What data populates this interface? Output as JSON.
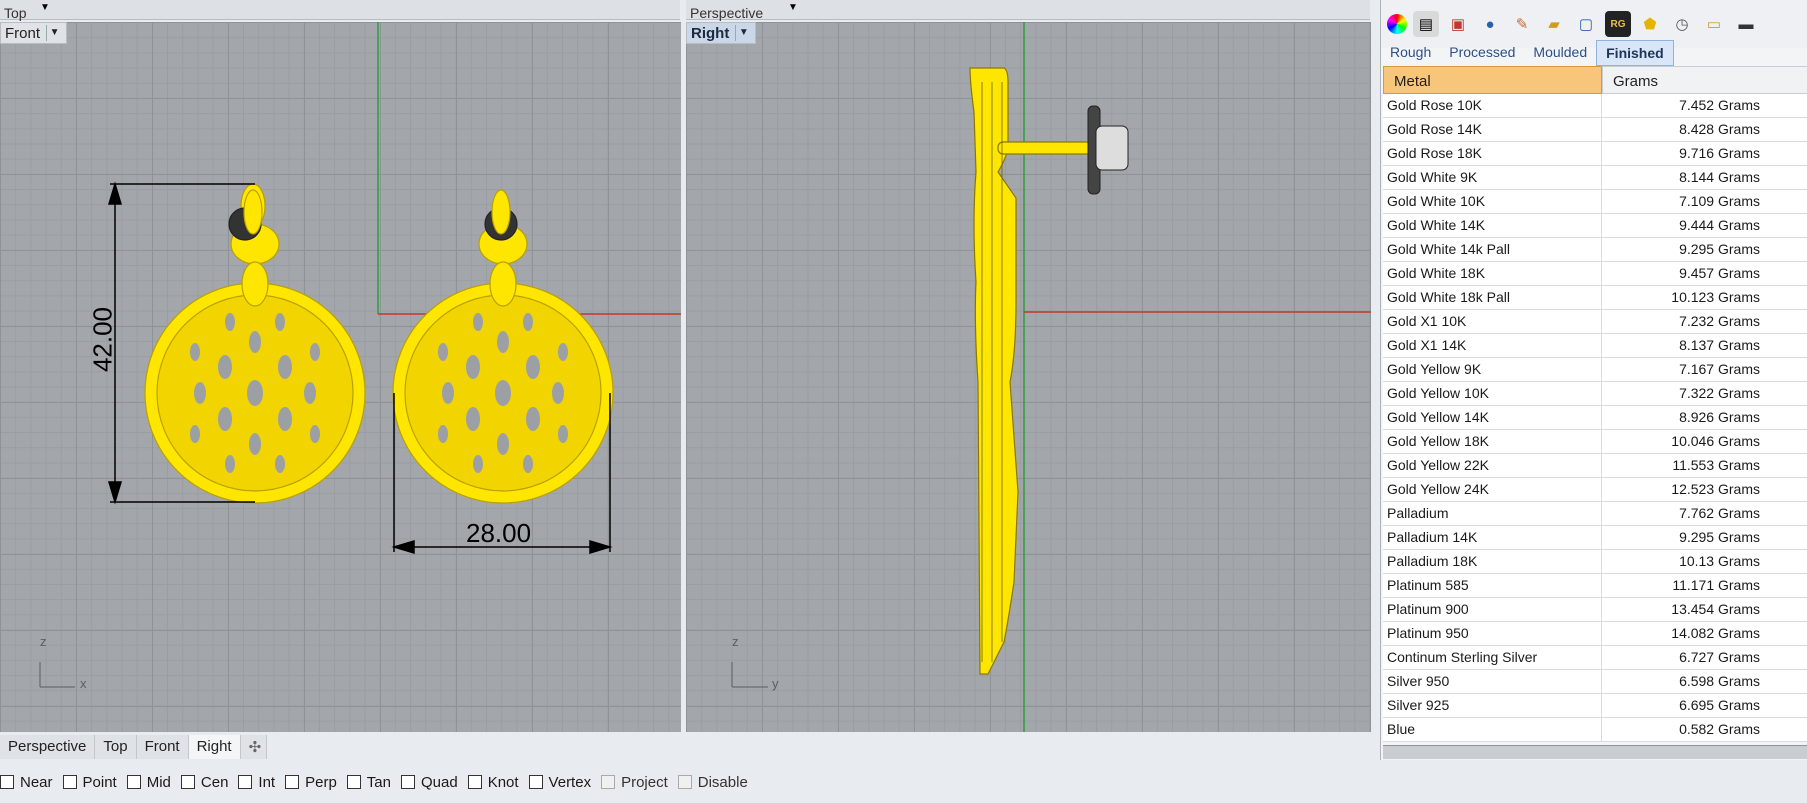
{
  "viewports": {
    "top": {
      "label": "Top"
    },
    "front": {
      "label": "Front",
      "dimensions": {
        "height": "42.00",
        "width": "28.00"
      },
      "axes": {
        "vertical": "z",
        "horizontal": "x"
      }
    },
    "perspective": {
      "label": "Perspective"
    },
    "right": {
      "label": "Right",
      "axes": {
        "vertical": "z",
        "horizontal": "y"
      }
    }
  },
  "panel": {
    "toolbar_icons": [
      "color-wheel-icon",
      "layers-icon",
      "layers-pin-icon",
      "render-sphere-icon",
      "pencil-icon",
      "folder-icon",
      "display-icon",
      "rg-icon",
      "weight-icon",
      "clock-icon",
      "notes-icon",
      "monitor-icon"
    ],
    "tabs": [
      "Rough",
      "Processed",
      "Moulded",
      "Finished"
    ],
    "active_tab": "Finished",
    "columns": {
      "metal": "Metal",
      "grams": "Grams"
    },
    "rows": [
      {
        "metal": "Gold Rose 10K",
        "grams": "7.452 Grams"
      },
      {
        "metal": "Gold Rose 14K",
        "grams": "8.428 Grams"
      },
      {
        "metal": "Gold Rose 18K",
        "grams": "9.716 Grams"
      },
      {
        "metal": "Gold White 9K",
        "grams": "8.144 Grams"
      },
      {
        "metal": "Gold White 10K",
        "grams": "7.109 Grams"
      },
      {
        "metal": "Gold White 14K",
        "grams": "9.444 Grams"
      },
      {
        "metal": "Gold White 14k Pall",
        "grams": "9.295 Grams"
      },
      {
        "metal": "Gold White 18K",
        "grams": "9.457 Grams"
      },
      {
        "metal": "Gold White 18k Pall",
        "grams": "10.123 Grams"
      },
      {
        "metal": "Gold X1 10K",
        "grams": "7.232 Grams"
      },
      {
        "metal": "Gold X1 14K",
        "grams": "8.137 Grams"
      },
      {
        "metal": "Gold Yellow 9K",
        "grams": "7.167 Grams"
      },
      {
        "metal": "Gold Yellow 10K",
        "grams": "7.322 Grams"
      },
      {
        "metal": "Gold Yellow 14K",
        "grams": "8.926 Grams"
      },
      {
        "metal": "Gold Yellow 18K",
        "grams": "10.046 Grams"
      },
      {
        "metal": "Gold Yellow 22K",
        "grams": "11.553 Grams"
      },
      {
        "metal": "Gold Yellow 24K",
        "grams": "12.523 Grams"
      },
      {
        "metal": "Palladium",
        "grams": "7.762 Grams"
      },
      {
        "metal": "Palladium 14K",
        "grams": "9.295 Grams"
      },
      {
        "metal": "Palladium 18K",
        "grams": "10.13 Grams"
      },
      {
        "metal": "Platinum 585",
        "grams": "11.171 Grams"
      },
      {
        "metal": "Platinum 900",
        "grams": "13.454 Grams"
      },
      {
        "metal": "Platinum 950",
        "grams": "14.082 Grams"
      },
      {
        "metal": "Continum Sterling Silver",
        "grams": "6.727 Grams"
      },
      {
        "metal": "Silver 950",
        "grams": "6.598 Grams"
      },
      {
        "metal": "Silver 925",
        "grams": "6.695 Grams"
      },
      {
        "metal": "Blue",
        "grams": "0.582 Grams"
      }
    ]
  },
  "viewport_tabs": [
    "Perspective",
    "Top",
    "Front",
    "Right"
  ],
  "active_viewport_tab": "Right",
  "osnaps": [
    {
      "label": "Near",
      "checked": false,
      "enabled": true
    },
    {
      "label": "Point",
      "checked": false,
      "enabled": true
    },
    {
      "label": "Mid",
      "checked": false,
      "enabled": true
    },
    {
      "label": "Cen",
      "checked": false,
      "enabled": true
    },
    {
      "label": "Int",
      "checked": false,
      "enabled": true
    },
    {
      "label": "Perp",
      "checked": false,
      "enabled": true
    },
    {
      "label": "Tan",
      "checked": false,
      "enabled": true
    },
    {
      "label": "Quad",
      "checked": false,
      "enabled": true
    },
    {
      "label": "Knot",
      "checked": false,
      "enabled": true
    },
    {
      "label": "Vertex",
      "checked": false,
      "enabled": true
    },
    {
      "label": "Project",
      "checked": false,
      "enabled": false
    },
    {
      "label": "Disable",
      "checked": false,
      "enabled": false
    }
  ],
  "colors": {
    "object_yellow": "#ffe600",
    "x_axis": "#c0392b",
    "y_axis": "#2e9e3e",
    "accent": "#f7c67a"
  }
}
